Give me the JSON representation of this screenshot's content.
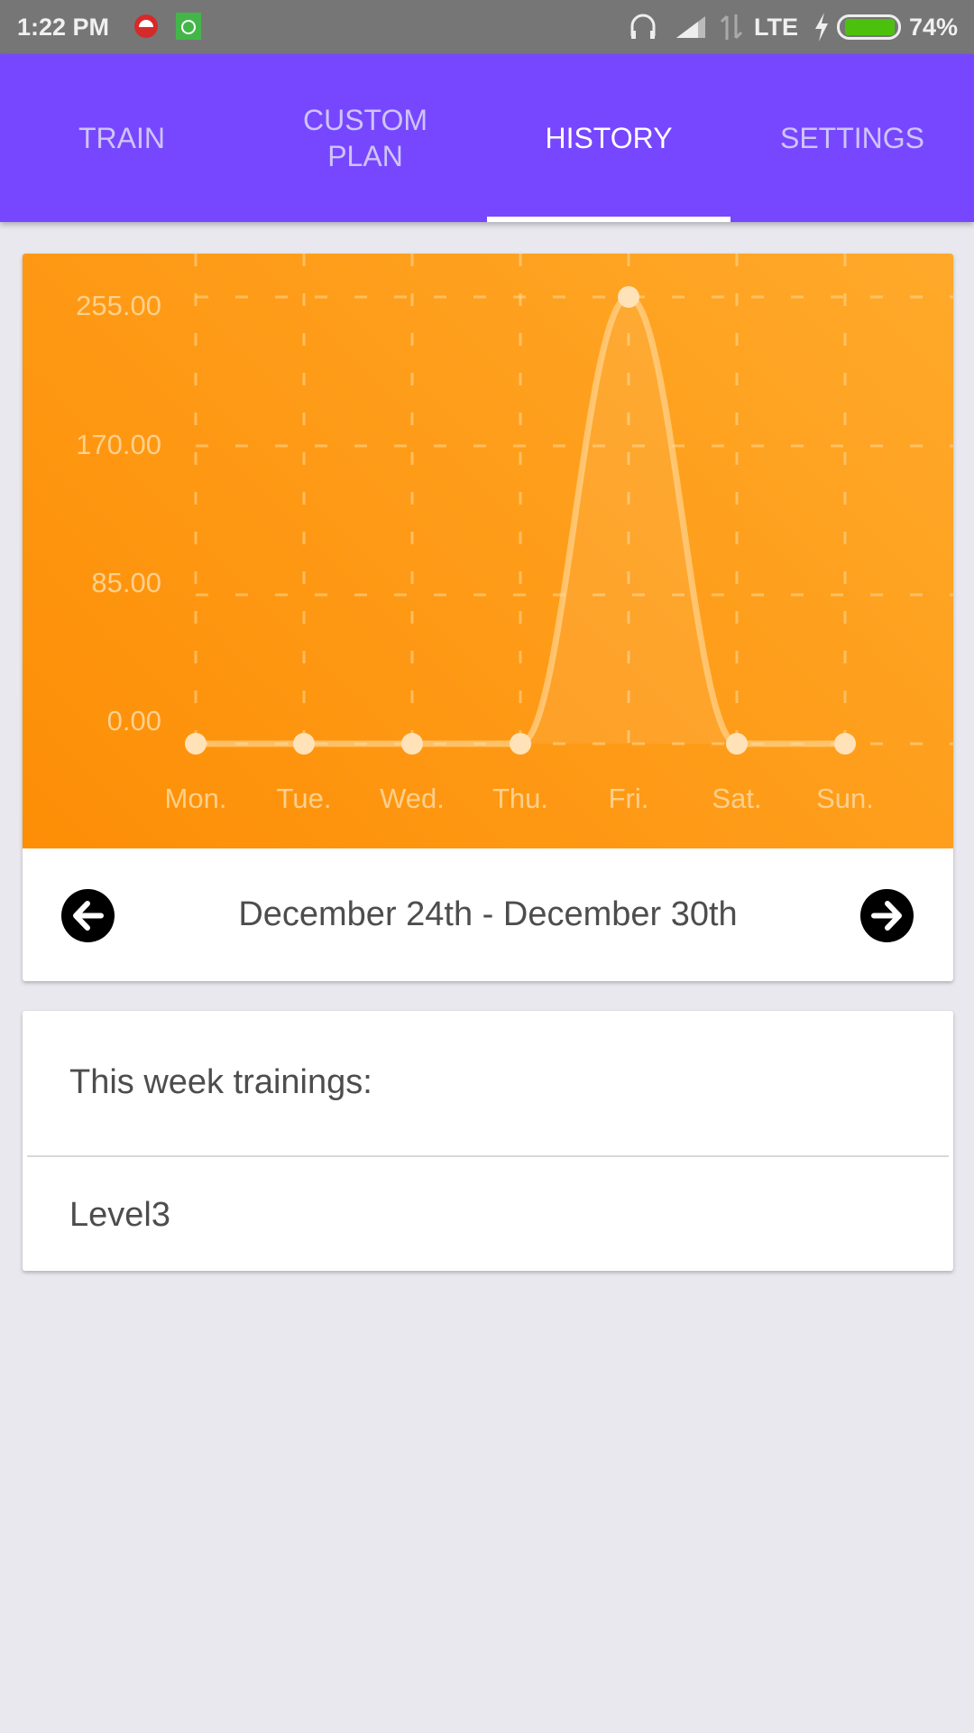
{
  "status_bar": {
    "time": "1:22 PM",
    "network": "LTE",
    "battery": "74%",
    "battery_level": 0.74
  },
  "tabs": [
    {
      "label": "TRAIN",
      "active": false
    },
    {
      "label": "CUSTOM PLAN",
      "active": false
    },
    {
      "label": "HISTORY",
      "active": true
    },
    {
      "label": "SETTINGS",
      "active": false
    }
  ],
  "colors": {
    "primary": "#7747ff",
    "chart_bg": "#fd9a12",
    "background": "#e9e8ef"
  },
  "chart_data": {
    "type": "line",
    "categories": [
      "Mon.",
      "Tue.",
      "Wed.",
      "Thu.",
      "Fri.",
      "Sat.",
      "Sun."
    ],
    "values": [
      0,
      0,
      0,
      0,
      255,
      0,
      0
    ],
    "yticks": [
      "0.00",
      "85.00",
      "170.00",
      "255.00"
    ],
    "ylim": [
      0,
      255
    ],
    "grid": true,
    "smooth": true
  },
  "week_nav": {
    "range": "December 24th - December 30th",
    "prev_icon": "arrow-left-circle-icon",
    "next_icon": "arrow-right-circle-icon"
  },
  "trainings": {
    "title": "This week trainings:",
    "items": [
      "Level3"
    ]
  }
}
